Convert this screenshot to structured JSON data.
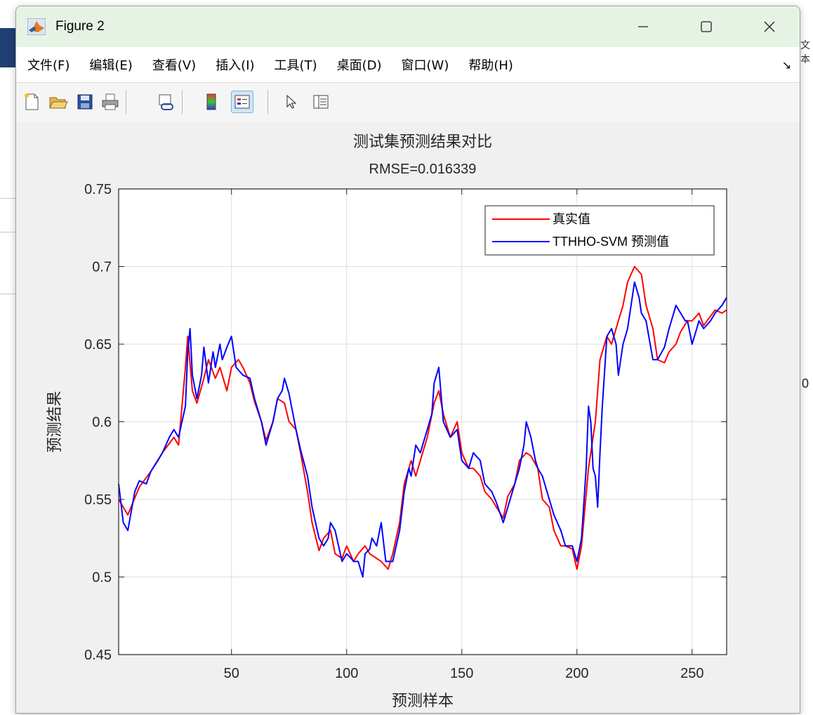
{
  "window": {
    "title": "Figure 2"
  },
  "background_app": {
    "right_text": "文本",
    "right_number": "0"
  },
  "menu": {
    "items": [
      "文件(F)",
      "编辑(E)",
      "查看(V)",
      "插入(I)",
      "工具(T)",
      "桌面(D)",
      "窗口(W)",
      "帮助(H)"
    ]
  },
  "toolbar": {
    "items": [
      "new-figure-icon",
      "open-file-icon",
      "save-icon",
      "print-icon",
      "link-plot-icon",
      "insert-colorbar-icon",
      "insert-legend-icon",
      "select-pointer-icon",
      "property-inspector-icon"
    ]
  },
  "chart_data": {
    "type": "line",
    "title": "测试集预测结果对比",
    "subtitle": "RMSE=0.016339",
    "xlabel": "预测样本",
    "ylabel": "预测结果",
    "xlim": [
      1,
      265
    ],
    "ylim": [
      0.45,
      0.75
    ],
    "x_ticks": [
      50,
      100,
      150,
      200,
      250
    ],
    "y_ticks": [
      "0.45",
      "0.5",
      "0.55",
      "0.6",
      "0.65",
      "0.7",
      "0.75"
    ],
    "grid": true,
    "legend_position": "top-right",
    "series": [
      {
        "name": "真实值",
        "color": "#ff0000",
        "x": [
          1,
          5,
          10,
          15,
          20,
          25,
          27,
          30,
          31,
          33,
          35,
          38,
          40,
          43,
          45,
          48,
          50,
          53,
          55,
          58,
          60,
          63,
          65,
          68,
          70,
          73,
          75,
          78,
          80,
          83,
          85,
          88,
          90,
          93,
          95,
          98,
          100,
          103,
          105,
          108,
          110,
          113,
          115,
          118,
          120,
          123,
          125,
          128,
          130,
          133,
          135,
          138,
          140,
          142,
          145,
          148,
          150,
          153,
          155,
          158,
          160,
          163,
          165,
          168,
          170,
          173,
          175,
          178,
          180,
          183,
          185,
          188,
          190,
          193,
          195,
          198,
          200,
          202,
          205,
          208,
          210,
          213,
          215,
          218,
          220,
          222,
          225,
          228,
          230,
          233,
          235,
          238,
          240,
          243,
          245,
          248,
          250,
          253,
          255,
          258,
          260,
          263,
          265
        ],
        "values": [
          0.55,
          0.54,
          0.558,
          0.568,
          0.58,
          0.59,
          0.585,
          0.635,
          0.655,
          0.62,
          0.612,
          0.628,
          0.64,
          0.628,
          0.635,
          0.62,
          0.635,
          0.64,
          0.635,
          0.625,
          0.613,
          0.6,
          0.588,
          0.6,
          0.615,
          0.612,
          0.6,
          0.595,
          0.58,
          0.555,
          0.535,
          0.517,
          0.525,
          0.53,
          0.515,
          0.512,
          0.52,
          0.51,
          0.515,
          0.52,
          0.515,
          0.512,
          0.51,
          0.505,
          0.515,
          0.535,
          0.56,
          0.575,
          0.565,
          0.58,
          0.59,
          0.612,
          0.62,
          0.605,
          0.59,
          0.6,
          0.58,
          0.57,
          0.57,
          0.565,
          0.555,
          0.55,
          0.545,
          0.538,
          0.552,
          0.56,
          0.575,
          0.58,
          0.578,
          0.57,
          0.55,
          0.545,
          0.53,
          0.52,
          0.52,
          0.518,
          0.505,
          0.52,
          0.57,
          0.6,
          0.64,
          0.655,
          0.65,
          0.665,
          0.675,
          0.69,
          0.7,
          0.695,
          0.675,
          0.66,
          0.64,
          0.638,
          0.645,
          0.65,
          0.658,
          0.665,
          0.665,
          0.67,
          0.662,
          0.668,
          0.672,
          0.67,
          0.672
        ]
      },
      {
        "name": "TTHHO-SVM 预测值",
        "color": "#0000ff",
        "x": [
          1,
          3,
          5,
          8,
          10,
          13,
          15,
          18,
          20,
          23,
          25,
          27,
          30,
          31,
          32,
          33,
          35,
          37,
          38,
          40,
          42,
          43,
          45,
          46,
          48,
          50,
          52,
          55,
          58,
          60,
          63,
          65,
          68,
          70,
          72,
          73,
          75,
          78,
          80,
          83,
          85,
          88,
          90,
          92,
          93,
          95,
          98,
          100,
          102,
          103,
          105,
          107,
          108,
          110,
          111,
          113,
          115,
          117,
          118,
          120,
          123,
          125,
          127,
          128,
          130,
          132,
          135,
          137,
          138,
          140,
          142,
          145,
          148,
          150,
          153,
          155,
          158,
          160,
          163,
          165,
          168,
          170,
          173,
          175,
          177,
          178,
          180,
          182,
          183,
          185,
          188,
          190,
          193,
          195,
          198,
          200,
          202,
          204,
          205,
          206,
          207,
          208,
          209,
          210,
          211,
          213,
          215,
          217,
          218,
          220,
          222,
          224,
          225,
          227,
          228,
          230,
          233,
          235,
          238,
          240,
          242,
          243,
          245,
          247,
          248,
          250,
          252,
          253,
          255,
          258,
          260,
          263,
          265
        ],
        "values": [
          0.56,
          0.535,
          0.53,
          0.555,
          0.562,
          0.56,
          0.568,
          0.575,
          0.58,
          0.59,
          0.595,
          0.59,
          0.61,
          0.645,
          0.66,
          0.63,
          0.615,
          0.63,
          0.648,
          0.625,
          0.645,
          0.635,
          0.65,
          0.64,
          0.648,
          0.655,
          0.635,
          0.63,
          0.628,
          0.615,
          0.6,
          0.585,
          0.6,
          0.615,
          0.62,
          0.628,
          0.618,
          0.595,
          0.582,
          0.565,
          0.545,
          0.525,
          0.52,
          0.525,
          0.535,
          0.53,
          0.51,
          0.515,
          0.512,
          0.51,
          0.51,
          0.5,
          0.515,
          0.518,
          0.525,
          0.52,
          0.535,
          0.51,
          0.51,
          0.51,
          0.53,
          0.555,
          0.57,
          0.565,
          0.585,
          0.58,
          0.595,
          0.605,
          0.625,
          0.635,
          0.6,
          0.59,
          0.595,
          0.575,
          0.57,
          0.58,
          0.575,
          0.56,
          0.555,
          0.548,
          0.535,
          0.545,
          0.56,
          0.57,
          0.585,
          0.6,
          0.59,
          0.575,
          0.57,
          0.565,
          0.55,
          0.54,
          0.53,
          0.52,
          0.52,
          0.51,
          0.525,
          0.57,
          0.61,
          0.6,
          0.57,
          0.565,
          0.545,
          0.58,
          0.61,
          0.655,
          0.66,
          0.65,
          0.63,
          0.65,
          0.66,
          0.68,
          0.69,
          0.68,
          0.67,
          0.665,
          0.64,
          0.64,
          0.648,
          0.66,
          0.67,
          0.675,
          0.67,
          0.665,
          0.665,
          0.65,
          0.66,
          0.665,
          0.66,
          0.665,
          0.67,
          0.675,
          0.68
        ]
      }
    ]
  }
}
